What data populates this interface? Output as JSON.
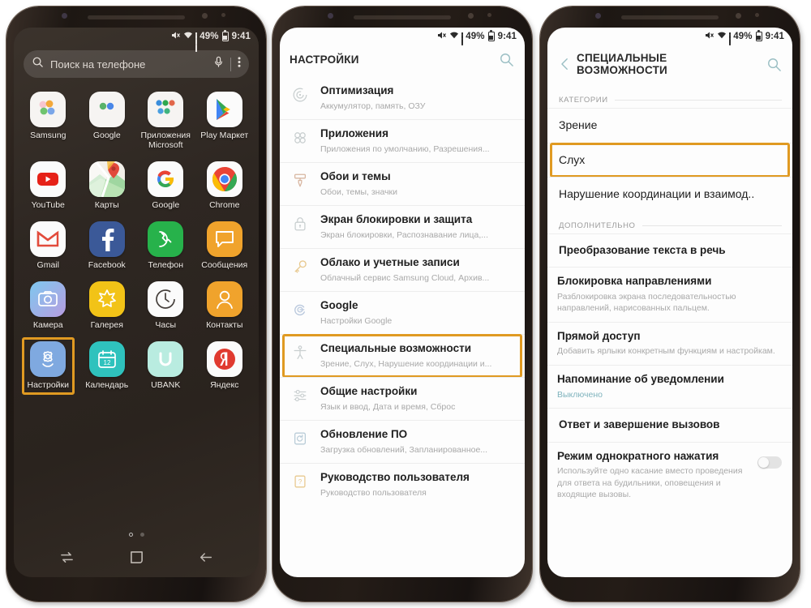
{
  "status_bar": {
    "mute_icon": "mute-icon",
    "wifi_icon": "wifi-icon",
    "signal_icon": "signal-icon",
    "battery_percent": "49%",
    "battery_icon": "battery-icon",
    "time": "9:41"
  },
  "phone1": {
    "search": {
      "placeholder": "Поиск на телефоне",
      "search_icon": "search-icon",
      "mic_icon": "microphone-icon",
      "more_icon": "more-vertical-icon"
    },
    "apps": [
      {
        "label": "Samsung",
        "icon": "samsung-folder-icon",
        "selected": false
      },
      {
        "label": "Google",
        "icon": "google-folder-icon",
        "selected": false
      },
      {
        "label": "Приложения Microsoft",
        "icon": "microsoft-folder-icon",
        "selected": false
      },
      {
        "label": "Play Маркет",
        "icon": "play-store-icon",
        "selected": false
      },
      {
        "label": "YouTube",
        "icon": "youtube-icon",
        "selected": false
      },
      {
        "label": "Карты",
        "icon": "google-maps-icon",
        "selected": false
      },
      {
        "label": "Google",
        "icon": "google-icon",
        "selected": false
      },
      {
        "label": "Chrome",
        "icon": "chrome-icon",
        "selected": false
      },
      {
        "label": "Gmail",
        "icon": "gmail-icon",
        "selected": false
      },
      {
        "label": "Facebook",
        "icon": "facebook-icon",
        "selected": false
      },
      {
        "label": "Телефон",
        "icon": "phone-icon",
        "selected": false
      },
      {
        "label": "Сообщения",
        "icon": "messages-icon",
        "selected": false
      },
      {
        "label": "Камера",
        "icon": "camera-icon",
        "selected": false
      },
      {
        "label": "Галерея",
        "icon": "gallery-icon",
        "selected": false
      },
      {
        "label": "Часы",
        "icon": "clock-icon",
        "selected": false
      },
      {
        "label": "Контакты",
        "icon": "contacts-icon",
        "selected": false
      },
      {
        "label": "Настройки",
        "icon": "settings-gear-icon",
        "selected": true
      },
      {
        "label": "Календарь",
        "icon": "calendar-icon",
        "selected": false
      },
      {
        "label": "UBANK",
        "icon": "ubank-icon",
        "selected": false
      },
      {
        "label": "Яндекс",
        "icon": "yandex-icon",
        "selected": false
      }
    ],
    "page_dots": {
      "count": 2,
      "active": 0
    },
    "nav": {
      "recents_icon": "recents-icon",
      "home_icon": "home-icon",
      "back_icon": "back-icon"
    }
  },
  "phone2": {
    "title": "НАСТРОЙКИ",
    "search_icon": "search-icon",
    "items": [
      {
        "title": "Оптимизация",
        "sub": "Аккумулятор, память, ОЗУ",
        "icon": "optimization-icon",
        "highlighted": false
      },
      {
        "title": "Приложения",
        "sub": "Приложения по умолчанию, Разрешения...",
        "icon": "apps-icon",
        "highlighted": false
      },
      {
        "title": "Обои и темы",
        "sub": "Обои, темы, значки",
        "icon": "wallpaper-icon",
        "highlighted": false
      },
      {
        "title": "Экран блокировки и защита",
        "sub": "Экран блокировки, Распознавание лица,...",
        "icon": "lock-icon",
        "highlighted": false
      },
      {
        "title": "Облако и учетные записи",
        "sub": "Облачный сервис Samsung Cloud, Архив...",
        "icon": "key-icon",
        "highlighted": false
      },
      {
        "title": "Google",
        "sub": "Настройки Google",
        "icon": "google-g-icon",
        "highlighted": false
      },
      {
        "title": "Специальные возможности",
        "sub": "Зрение, Слух, Нарушение координации и...",
        "icon": "accessibility-icon",
        "highlighted": true
      },
      {
        "title": "Общие настройки",
        "sub": "Язык и ввод, Дата и время, Сброс",
        "icon": "sliders-icon",
        "highlighted": false
      },
      {
        "title": "Обновление ПО",
        "sub": "Загрузка обновлений, Запланированное...",
        "icon": "software-update-icon",
        "highlighted": false
      },
      {
        "title": "Руководство пользователя",
        "sub": "Руководство пользователя",
        "icon": "manual-icon",
        "highlighted": false
      }
    ]
  },
  "phone3": {
    "title": "СПЕЦИАЛЬНЫЕ ВОЗМОЖНОСТИ",
    "back_icon": "back-chevron-icon",
    "search_icon": "search-icon",
    "section_categories": "КАТЕГОРИИ",
    "section_additional": "ДОПОЛНИТЕЛЬНО",
    "categories": [
      {
        "title": "Зрение",
        "highlighted": false
      },
      {
        "title": "Слух",
        "highlighted": true
      },
      {
        "title": "Нарушение координации и взаимод..",
        "highlighted": false
      }
    ],
    "additional": [
      {
        "title": "Преобразование текста в речь",
        "sub": "",
        "toggle": null
      },
      {
        "title": "Блокировка направлениями",
        "sub": "Разблокировка экрана последовательностью направлений, нарисованных пальцем.",
        "toggle": null
      },
      {
        "title": "Прямой доступ",
        "sub": "Добавить ярлыки конкретным функциям и настройкам.",
        "toggle": null
      },
      {
        "title": "Напоминание об уведомлении",
        "sub": "Выключено",
        "toggle": null,
        "sub_state": true
      },
      {
        "title": "Ответ и завершение вызовов",
        "sub": "",
        "toggle": null
      },
      {
        "title": "Режим однократного нажатия",
        "sub": "Используйте одно касание вместо проведения для ответа на будильники, оповещения и входящие вызовы.",
        "toggle": "off"
      }
    ]
  },
  "colors": {
    "highlight": "#e09a22",
    "accent_teal": "#7fb3bd",
    "bezel": "#241c17"
  }
}
